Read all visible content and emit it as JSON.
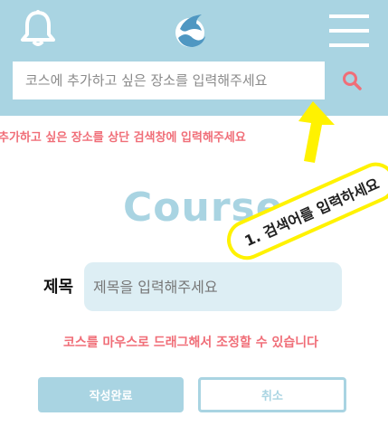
{
  "header": {
    "search_placeholder": "코스에 추가하고 싶은 장소를 입력해주세요",
    "icons": [
      "bell-icon",
      "dolphin-logo",
      "hamburger-menu-icon",
      "search-icon"
    ],
    "colors": {
      "header_bg": "#a9d4e2",
      "accent_red": "#f06e78",
      "highlight_yellow": "#fff200"
    }
  },
  "hint": "추가하고 싶은 장소를 상단 검색창에 입력해주세요",
  "callout": "1. 검색어를 입력하세요",
  "course_heading": "Course",
  "form": {
    "title_label": "제목",
    "title_placeholder": "제목을 입력해주세요",
    "drag_hint": "코스를 마우스로 드래그해서 조정할 수 있습니다",
    "submit_label": "작성완료",
    "cancel_label": "취소"
  }
}
